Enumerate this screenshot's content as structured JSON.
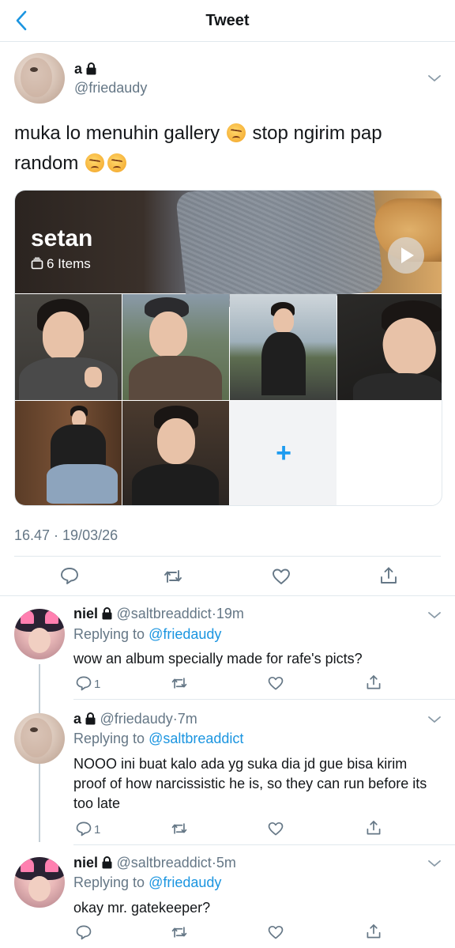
{
  "header": {
    "title": "Tweet"
  },
  "tweet": {
    "name": "a",
    "handle": "@friedaudy",
    "text_part1": "muka lo menuhin gallery",
    "text_part2": "stop ngirim pap",
    "text_part3": "random",
    "album": {
      "title": "setan",
      "count": "6 Items"
    },
    "meta": "16.47 · 19/03/26"
  },
  "replies": [
    {
      "name": "niel",
      "handle": "@saltbreaddict",
      "time": "19m",
      "replying_prefix": "Replying to",
      "replying_to": "@friedaudy",
      "text": "wow an album specially made for rafe's picts?",
      "reply_count": "1"
    },
    {
      "name": "a",
      "handle": "@friedaudy",
      "time": "7m",
      "replying_prefix": "Replying to",
      "replying_to": "@saltbreaddict",
      "text": "NOOO ini buat kalo ada yg suka dia jd gue bisa kirim proof of how narcissistic he is, so they can run before its too late",
      "reply_count": "1"
    },
    {
      "name": "niel",
      "handle": "@saltbreaddict",
      "time": "5m",
      "replying_prefix": "Replying to",
      "replying_to": "@friedaudy",
      "text": "okay mr. gatekeeper?",
      "reply_count": ""
    }
  ],
  "colors": {
    "accent": "#1b95e0",
    "muted": "#657786",
    "text": "#14171a",
    "divider": "#e1e8ed"
  },
  "icons": [
    "back-icon",
    "lock-icon",
    "chevron-down-icon",
    "album-icon",
    "play-icon",
    "plus-icon",
    "reply-icon",
    "retweet-icon",
    "like-icon",
    "share-icon"
  ]
}
